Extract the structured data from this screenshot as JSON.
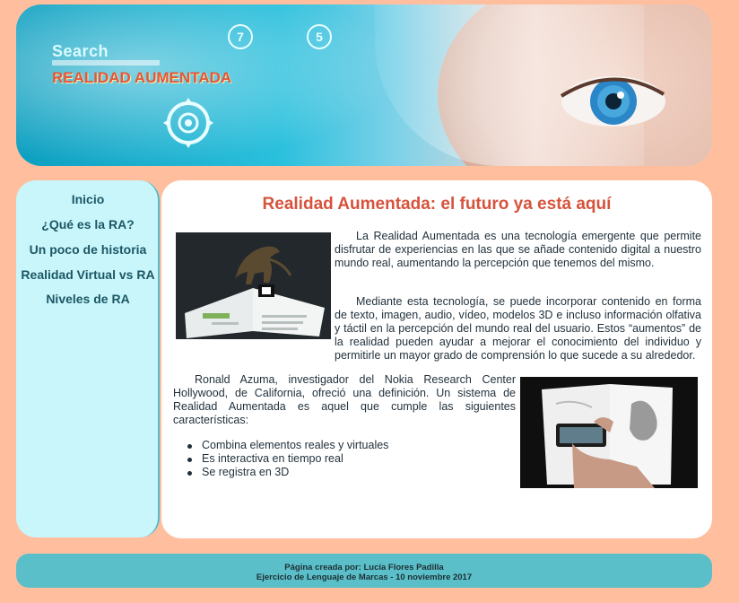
{
  "header": {
    "search_label": "Search",
    "banner_title": "REALIDAD AUMENTADA",
    "badge_1": "7",
    "badge_2": "5"
  },
  "sidebar": {
    "items": [
      {
        "label": "Inicio"
      },
      {
        "label": "¿Qué es la RA?"
      },
      {
        "label": "Un poco de historia"
      },
      {
        "label": "Realidad Virtual vs RA"
      },
      {
        "label": "Niveles de RA"
      }
    ]
  },
  "main": {
    "title": "Realidad Aumentada: el futuro ya está aquí",
    "paragraphs": [
      "La Realidad Aumentada es una tecnología emergente que permite disfrutar de experiencias en las que se añade contenido digital a nuestro mundo real, aumentando la percepción que tenemos del mismo.",
      "Mediante esta tecnología, se puede incorporar contenido en forma de texto, imagen, audio, vídeo, modelos 3D e incluso información olfativa y táctil en la percepción del mundo real del usuario. Estos “aumentos” de la realidad pueden ayudar a mejorar el conocimiento del individuo y permitirle un mayor grado de comprensión lo que sucede a su alrededor.",
      "Ronald Azuma, investigador del Nokia Research Center Hollywood, de California, ofreció una definición. Un sistema de Realidad Aumentada es aquel que cumple las siguientes características:"
    ],
    "features": [
      "Combina elementos reales y virtuales",
      "Es interactiva en tiempo real",
      "Se registra en 3D"
    ]
  },
  "footer": {
    "credit": "Página creada por: Lucía Flores Padilla",
    "course": "Ejercicio de Lenguaje de Marcas - 10 noviembre 2017"
  },
  "colors": {
    "background": "#ffbf9f",
    "sidebar": "#c9f6fb",
    "footer": "#5bbfc9",
    "title": "#d6533c",
    "nav_text": "#1c5765"
  }
}
